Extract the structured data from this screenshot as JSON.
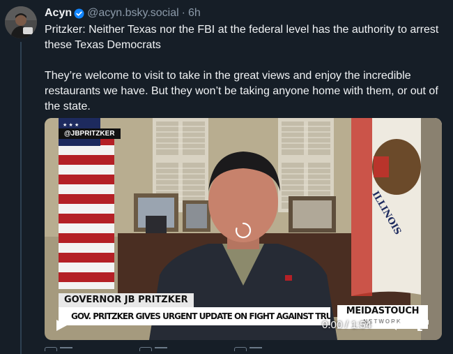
{
  "author": {
    "name": "Acyn",
    "handle": "@acyn.bsky.social",
    "separator": "·",
    "time": "6h",
    "verified_icon": "verified-check-icon"
  },
  "post": {
    "paragraphs": [
      "Pritzker: Neither Texas nor the FBI at the federal level has the authority to arrest these Texas Democrats",
      "They’re welcome to visit to take in the great views and enjoy the incredible restaurants we have. But they won’t be taking anyone home with them, or out of the state."
    ]
  },
  "video": {
    "handle_tag": "@JBPRITZKER",
    "lower_third_name": "GOVERNOR JB PRITZKER",
    "headline": "GOV. PRITZKER GIVES URGENT UPDATE ON FIGHT AGAINST TRUMP",
    "network_top": "MEIDASTOUCH",
    "network_bottom": "NETWORK",
    "flag_text": "ILLINOIS",
    "current_time": "0:00",
    "time_separator": "/",
    "duration": "1:54",
    "progress": 0.0,
    "colors": {
      "accent": "#1185fe",
      "background": "#161e27",
      "muted_text": "#8c9aa9"
    }
  }
}
